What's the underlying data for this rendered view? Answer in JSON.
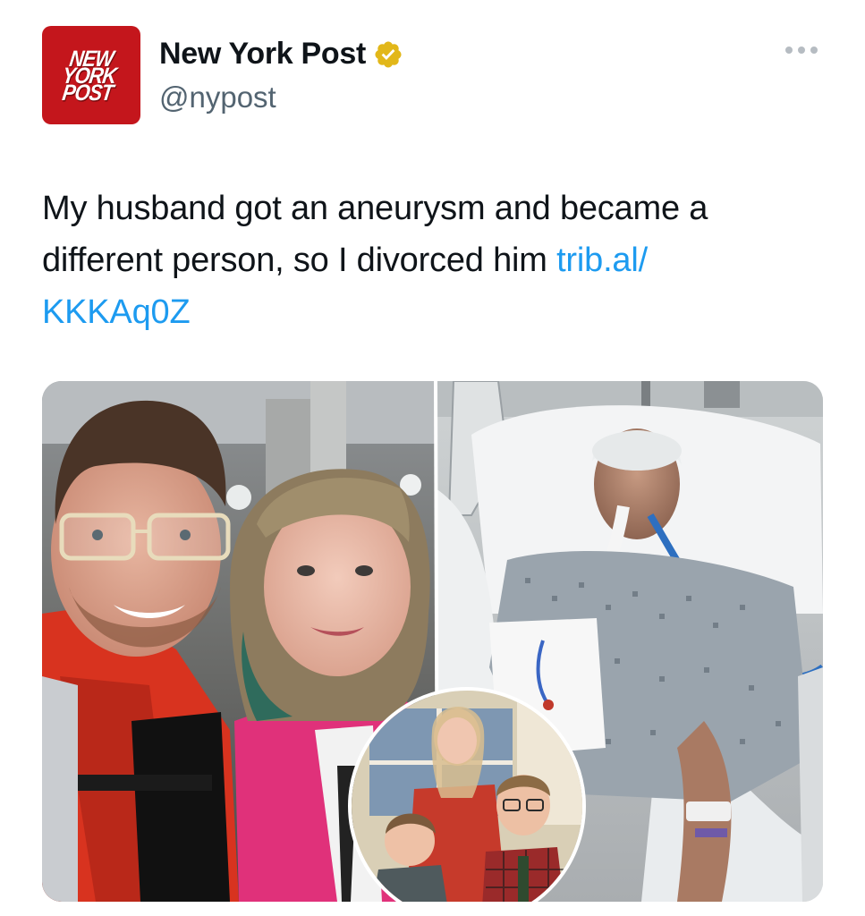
{
  "author": {
    "logo_lines": [
      "NEW",
      "YORK",
      "POST"
    ],
    "display_name": "New York Post",
    "handle": "@nypost",
    "verified_badge": "gold-verified-icon"
  },
  "more_icon": "more-horizontal-icon",
  "tweet": {
    "text": "My husband got an aneurysm and became a different person, so I divorced him ",
    "link_text": "trib.al/\nKKKAq0Z"
  },
  "media": {
    "count": 2,
    "inset_circle": true
  },
  "colors": {
    "brand_red": "#c4161c",
    "link_blue": "#1d9bf0",
    "verified_gold": "#e2b719",
    "text_primary": "#0f1419",
    "text_secondary": "#536471"
  }
}
